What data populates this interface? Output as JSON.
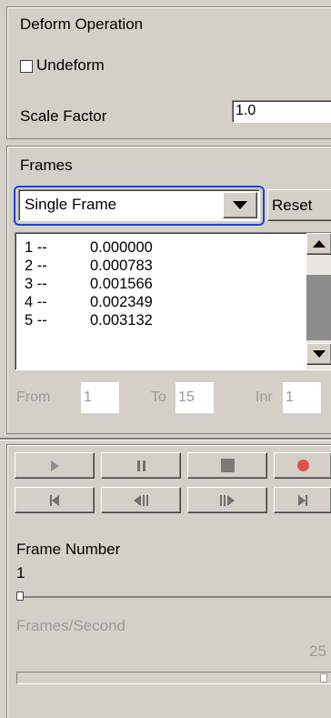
{
  "deform": {
    "title": "Deform Operation",
    "undeform_label": "Undeform",
    "undeform_checked": false,
    "scale_label": "Scale Factor",
    "scale_value": "1.0"
  },
  "frames": {
    "title": "Frames",
    "mode_selected": "Single Frame",
    "reset_label": "Reset",
    "list": [
      {
        "num": "1 --",
        "val": "0.000000"
      },
      {
        "num": "2 --",
        "val": "0.000783"
      },
      {
        "num": "3 --",
        "val": "0.001566"
      },
      {
        "num": "4 --",
        "val": "0.002349"
      },
      {
        "num": "5 --",
        "val": "0.003132"
      }
    ],
    "from_label": "From",
    "from_value": "1",
    "to_label": "To",
    "to_value": "15",
    "inr_label": "Inr",
    "inr_value": "1"
  },
  "playback": {
    "buttons": [
      {
        "name": "play",
        "glyph": "▶"
      },
      {
        "name": "pause",
        "glyph": "❙❙"
      },
      {
        "name": "stop",
        "glyph": "■"
      },
      {
        "name": "record",
        "glyph": "●"
      },
      {
        "name": "first-frame",
        "glyph": "▏◀"
      },
      {
        "name": "step-back",
        "glyph": "◀❙"
      },
      {
        "name": "step-forward",
        "glyph": "❙▶"
      },
      {
        "name": "last-frame",
        "glyph": "▶▕"
      }
    ],
    "frame_number_label": "Frame Number",
    "frame_number_value": "1",
    "fps_label": "Frames/Second",
    "fps_value": "25"
  },
  "colors": {
    "background": "#d4d0c8",
    "focus_ring": "#1f3fd6",
    "record": "#e05050",
    "disabled_text": "#9a9a9a"
  }
}
